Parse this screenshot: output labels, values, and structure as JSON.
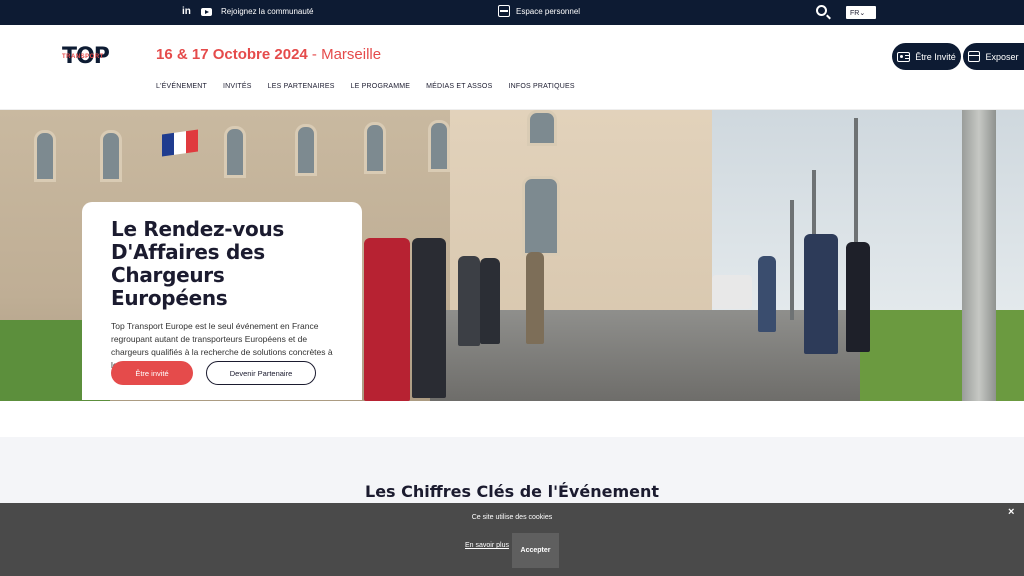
{
  "topbar": {
    "linkedin_label": "in",
    "community": "Rejoignez la communauté",
    "espace": "Espace personnel",
    "lang": "FR⌄"
  },
  "header": {
    "logo_main": "TOP",
    "logo_sub": "TRANSPORT",
    "dates": "16 & 17 Octobre 2024",
    "city": " - Marseille",
    "nav": [
      "L'ÉVÉNEMENT",
      "INVITÉS",
      "LES PARTENAIRES",
      "LE PROGRAMME",
      "MÉDIAS ET ASSOS",
      "INFOS PRATIQUES"
    ],
    "guest_button": "Être Invité",
    "expo_button": "Exposer"
  },
  "hero": {
    "title": "Le Rendez-vous D'Affaires des Chargeurs Européens",
    "description": "Top Transport Europe est le seul événement en France regroupant autant de transporteurs Européens et de chargeurs qualifiés à la recherche de solutions concrètes à leurs besoins.",
    "cta_primary": "Être invité",
    "cta_secondary": "Devenir Partenaire"
  },
  "figures": {
    "title": "Les Chiffres Clés de l'Événement"
  },
  "cookie": {
    "message": "Ce site utilise des cookies",
    "more": "En savoir plus",
    "accept": "Accepter",
    "close": "×"
  },
  "colors": {
    "navy": "#0d1b33",
    "accent": "#e54b4b"
  }
}
